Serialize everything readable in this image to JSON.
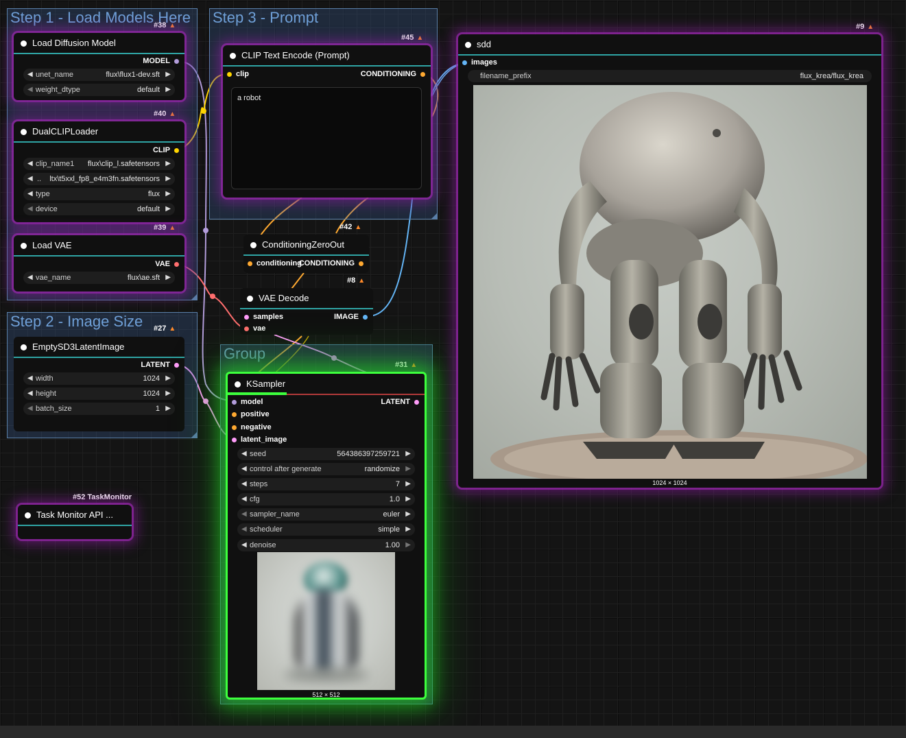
{
  "groups": {
    "step1": "Step 1 - Load Models Here",
    "step2": "Step 2 - Image Size",
    "step3": "Step 3 - Prompt",
    "group": "Group"
  },
  "nodes": {
    "load_diffusion": {
      "badge": "#38",
      "title": "Load Diffusion Model",
      "output": "MODEL",
      "widgets": [
        {
          "label": "unet_name",
          "value": "flux\\flux1-dev.sft"
        },
        {
          "label": "weight_dtype",
          "value": "default"
        }
      ]
    },
    "dual_clip": {
      "badge": "#40",
      "title": "DualCLIPLoader",
      "output": "CLIP",
      "widgets": [
        {
          "label": "clip_name1",
          "value": "flux\\clip_l.safetensors"
        },
        {
          "label": "..",
          "value": "ltx\\t5xxl_fp8_e4m3fn.safetensors"
        },
        {
          "label": "type",
          "value": "flux"
        },
        {
          "label": "device",
          "value": "default"
        }
      ]
    },
    "load_vae": {
      "badge": "#39",
      "title": "Load VAE",
      "output": "VAE",
      "widgets": [
        {
          "label": "vae_name",
          "value": "flux\\ae.sft"
        }
      ]
    },
    "empty_latent": {
      "badge": "#27",
      "title": "EmptySD3LatentImage",
      "output": "LATENT",
      "widgets": [
        {
          "label": "width",
          "value": "1024"
        },
        {
          "label": "height",
          "value": "1024"
        },
        {
          "label": "batch_size",
          "value": "1"
        }
      ]
    },
    "clip_text": {
      "badge": "#45",
      "title": "CLIP Text Encode (Prompt)",
      "input": "clip",
      "output": "CONDITIONING",
      "prompt": "a robot"
    },
    "cond_zero": {
      "badge": "#42",
      "title": "ConditioningZeroOut",
      "input": "conditioning",
      "output": "CONDITIONING"
    },
    "vae_decode": {
      "badge": "#8",
      "title": "VAE Decode",
      "inputs": [
        "samples",
        "vae"
      ],
      "output": "IMAGE"
    },
    "ksampler": {
      "badge": "#31",
      "title": "KSampler",
      "inputs": [
        "model",
        "positive",
        "negative",
        "latent_image"
      ],
      "output": "LATENT",
      "progress": 0.3,
      "widgets": [
        {
          "label": "seed",
          "value": "564386397259721"
        },
        {
          "label": "control after generate",
          "value": "randomize"
        },
        {
          "label": "steps",
          "value": "7"
        },
        {
          "label": "cfg",
          "value": "1.0"
        },
        {
          "label": "sampler_name",
          "value": "euler"
        },
        {
          "label": "scheduler",
          "value": "simple"
        },
        {
          "label": "denoise",
          "value": "1.00"
        }
      ],
      "preview_size": "512 × 512"
    },
    "save": {
      "badge": "#9",
      "title": "sdd",
      "input": "images",
      "widgets": [
        {
          "label": "filename_prefix",
          "value": "flux_krea/flux_krea"
        }
      ],
      "image_size": "1024 × 1024"
    },
    "task_monitor": {
      "badge": "#52 TaskMonitor",
      "title": "Task Monitor API ..."
    }
  },
  "colors": {
    "model": "#b39ddb",
    "clip": "#ffd500",
    "conditioning": "#ffa931",
    "vae": "#ff6e6e",
    "latent": "#ff9cf9",
    "image": "#64b5f6",
    "accent_header": "#2fa5a5",
    "selected": "#3dff3d"
  }
}
